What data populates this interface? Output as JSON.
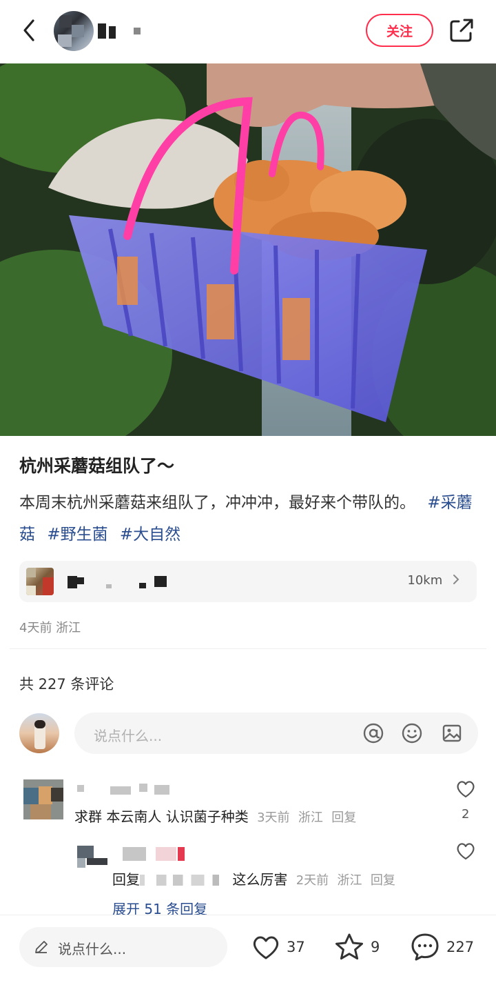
{
  "header": {
    "back_icon": "chevron-left-icon",
    "follow_label": "关注",
    "share_icon": "share-external-icon"
  },
  "post": {
    "title": "杭州采蘑菇组队了～",
    "body": "本周末杭州采蘑菇来组队了，冲冲冲，最好来个带队的。",
    "tags": [
      "#采蘑菇",
      "#野生菌",
      "#大自然"
    ],
    "location_distance": "10km",
    "meta": "4天前 浙江"
  },
  "comments_section": {
    "count_label": "共 227 条评论",
    "input_placeholder": "说点什么...",
    "input_icons": [
      "at-icon",
      "emoji-icon",
      "image-icon"
    ]
  },
  "comments": [
    {
      "text": "求群 本云南人 认识菌子种类",
      "time": "3天前",
      "region": "浙江",
      "reply_label": "回复",
      "likes": "2"
    }
  ],
  "reply": {
    "prefix": "回复",
    "text": "这么厉害",
    "time": "2天前",
    "region": "浙江",
    "reply_label": "回复",
    "expand_label": "展开 51 条回复"
  },
  "bottom_bar": {
    "input_placeholder": "说点什么...",
    "likes": "37",
    "favorites": "9",
    "comments": "227"
  },
  "colors": {
    "accent": "#ff2e4d",
    "tag": "#2a4d8f"
  }
}
